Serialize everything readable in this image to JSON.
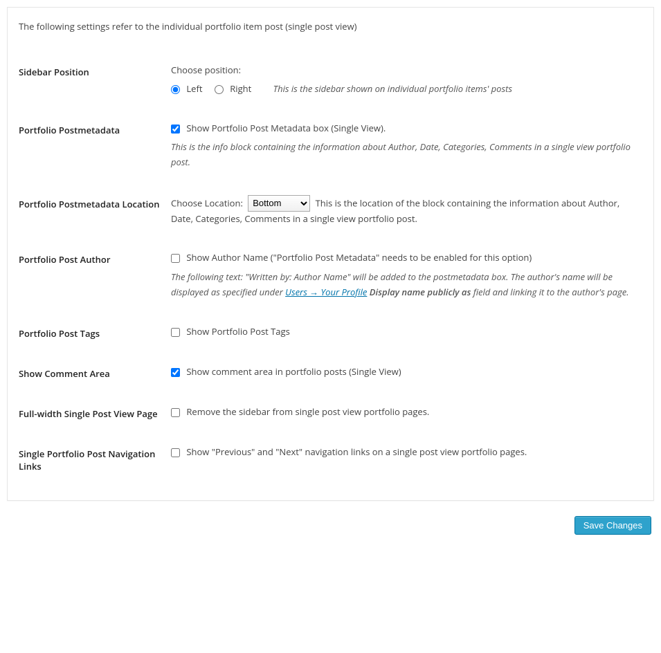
{
  "intro": "The following settings refer to the individual portfolio item post (single post view)",
  "rows": {
    "sidebar_position": {
      "th": "Sidebar Position",
      "choose_label": "Choose position:",
      "left": "Left",
      "right": "Right",
      "hint": "This is the sidebar shown on individual portfolio items' posts"
    },
    "postmeta": {
      "th": "Portfolio Postmetadata",
      "cb_label": "Show Portfolio Post Metadata box (Single View).",
      "desc": "This is the info block containing the information about Author, Date, Categories, Comments in a single view portfolio post."
    },
    "postmeta_location": {
      "th": "Portfolio Postmetadata Location",
      "choose_label": "Choose Location:",
      "option_bottom": "Bottom",
      "trail": "This is the location of the block containing the information about Author, Date, Categories, Comments in a single view portfolio post."
    },
    "author": {
      "th": "Portfolio Post Author",
      "cb_label": "Show Author Name (\"Portfolio Post Metadata\" needs to be enabled for this option)",
      "desc_a": "The following text: \"Written by: Author Name\" will be added to the postmetadata box. The author's name will be displayed as specified under ",
      "link": "Users → Your Profile",
      "display_bold": "Display name publicly as",
      "desc_b": " field and linking it to the author's page."
    },
    "tags": {
      "th": "Portfolio Post Tags",
      "cb_label": "Show Portfolio Post Tags"
    },
    "comments": {
      "th": "Show Comment Area",
      "cb_label": "Show comment area in portfolio posts (Single View)"
    },
    "fullwidth": {
      "th": "Full-width Single Post View Page",
      "cb_label": "Remove the sidebar from single post view portfolio pages."
    },
    "navlinks": {
      "th": "Single Portfolio Post Navigation Links",
      "cb_label": "Show \"Previous\" and \"Next\" navigation links on a single post view portfolio pages."
    }
  },
  "button": {
    "save": "Save Changes"
  }
}
